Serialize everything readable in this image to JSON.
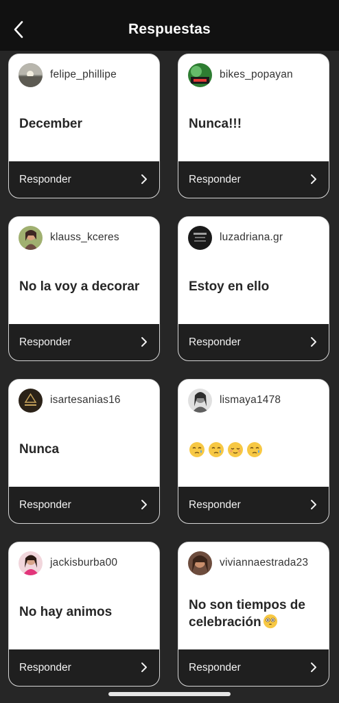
{
  "header": {
    "title": "Respuestas",
    "back_icon": "chevron-left-icon"
  },
  "cards": [
    {
      "username": "felipe_phillipe",
      "message": "December",
      "action": "Responder"
    },
    {
      "username": "bikes_popayan",
      "message": "Nunca!!!",
      "action": "Responder"
    },
    {
      "username": "klauss_kceres",
      "message": "No la voy a decorar",
      "action": "Responder"
    },
    {
      "username": "luzadriana.gr",
      "message": "Estoy en ello",
      "action": "Responder"
    },
    {
      "username": "isartesanias16",
      "message": "Nunca",
      "action": "Responder"
    },
    {
      "username": "lismaya1478",
      "message": "",
      "emojis": [
        "sleepy-face-emoji",
        "sleepy-face-emoji",
        "relieved-face-emoji",
        "sleepy-face-emoji"
      ],
      "action": "Responder"
    },
    {
      "username": "jackisburba00",
      "message": "No hay animos",
      "action": "Responder"
    },
    {
      "username": "viviannaestrada23",
      "message": "No son tiempos de celebración",
      "emoji": "flushed-face-emoji",
      "action": "Responder"
    }
  ],
  "colors": {
    "background": "#262626",
    "header": "#111111",
    "card": "#ffffff",
    "card_footer": "#1f1f1f"
  }
}
